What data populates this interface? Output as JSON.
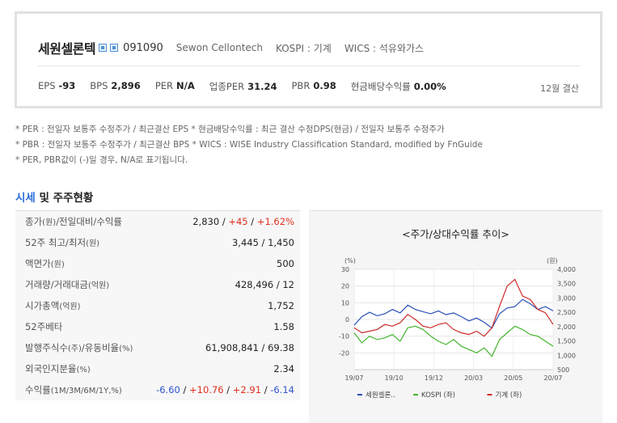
{
  "company": {
    "name": "세원셀론텍",
    "code": "091090",
    "english_name": "Sewon Cellontech",
    "market": "KOSPI : 기계",
    "wics": "WICS : 석유와가스"
  },
  "stats": {
    "eps_label": "EPS",
    "eps": "-93",
    "bps_label": "BPS",
    "bps": "2,896",
    "per_label": "PER",
    "per": "N/A",
    "industry_per_label": "업종PER",
    "industry_per": "31.24",
    "pbr_label": "PBR",
    "pbr": "0.98",
    "div_label": "현금배당수익률",
    "div": "0.00%",
    "settlement": "12월 결산"
  },
  "notes": [
    "* PER : 전일자 보통주 수정주가 / 최근결산 EPS * 현금배당수익률 : 최근 결산 수정DPS(현금) / 전일자 보통주 수정주가",
    "* PBR : 전일자 보통주 수정주가 / 최근결산 BPS * WICS : WISE Industry Classification Standard, modified by FnGuide",
    "* PER, PBR값이 (-)일 경우, N/A로 표기됩니다."
  ],
  "section": {
    "accent": "시세",
    "rest": " 및 주주현황"
  },
  "table": [
    {
      "label": "종가",
      "unit": "(원)",
      "label2": "/전일대비/수익률",
      "value": "2,830",
      "value2": "+45",
      "value3": "+1.62%"
    },
    {
      "label": "52주 최고/최저",
      "unit": "(원)",
      "value": "3,445 / 1,450"
    },
    {
      "label": "액면가",
      "unit": "(원)",
      "value": "500"
    },
    {
      "label": "거래량/거래대금",
      "unit": "(억원)",
      "value": "428,496 / 12"
    },
    {
      "label": "시가총액",
      "unit": "(억원)",
      "value": "1,752"
    },
    {
      "label": "52주베타",
      "unit": "",
      "value": "1.58"
    },
    {
      "label": "발행주식수",
      "unit": "(주)",
      "label2": "/유동비율",
      "unit2": "(%)",
      "value": "61,908,841 / 69.38"
    },
    {
      "label": "외국인지분율",
      "unit": "(%)",
      "value": "2.34"
    },
    {
      "label": "수익률",
      "unit": "(1M/3M/6M/1Y,%)",
      "returns": [
        "-6.60",
        "+10.76",
        "+2.91",
        "-6.14"
      ]
    }
  ],
  "chart_data": {
    "type": "line",
    "title": "<주가/상대수익률 추이>",
    "y_left_unit": "(%)",
    "y_right_unit": "(원)",
    "y_left_ticks": [
      "30",
      "20",
      "10",
      "0",
      "-10",
      "-20"
    ],
    "y_right_ticks": [
      "4,000",
      "3,500",
      "3,000",
      "2,500",
      "2,000",
      "1,500",
      "1,000",
      "500"
    ],
    "x_ticks": [
      "19/07",
      "19/10",
      "19/12",
      "20/03",
      "20/05",
      "20/07"
    ],
    "ylim_left": [
      -30,
      30
    ],
    "ylim_right": [
      500,
      4000
    ],
    "series": [
      {
        "name": "세원셀론..",
        "color": "#2b4fb8",
        "axis": "right",
        "x": [
          0,
          2,
          4,
          6,
          8,
          10,
          12,
          14,
          16,
          18,
          20,
          22,
          24,
          26,
          28,
          30,
          32,
          34,
          36,
          38,
          40,
          42,
          44,
          46,
          48,
          50,
          52
        ],
        "values": [
          2050,
          2350,
          2500,
          2380,
          2450,
          2600,
          2480,
          2750,
          2600,
          2520,
          2450,
          2550,
          2420,
          2480,
          2350,
          2200,
          2300,
          2150,
          1950,
          2450,
          2650,
          2700,
          2950,
          2800,
          2600,
          2700,
          2550
        ]
      },
      {
        "name": "KOSPI (좌)",
        "color": "#44b52e",
        "axis": "left",
        "x": [
          0,
          2,
          4,
          6,
          8,
          10,
          12,
          14,
          16,
          18,
          20,
          22,
          24,
          26,
          28,
          30,
          32,
          34,
          36,
          38,
          40,
          42,
          44,
          46,
          48,
          50,
          52
        ],
        "values": [
          -8,
          -14,
          -10,
          -12,
          -11,
          -9,
          -13,
          -5,
          -4,
          -6,
          -10,
          -13,
          -15,
          -12,
          -16,
          -18,
          -20,
          -17,
          -22,
          -12,
          -8,
          -4,
          -6,
          -9,
          -10,
          -13,
          -16
        ]
      },
      {
        "name": "기계 (좌)",
        "color": "#cc2a2a",
        "axis": "left",
        "x": [
          0,
          2,
          4,
          6,
          8,
          10,
          12,
          14,
          16,
          18,
          20,
          22,
          24,
          26,
          28,
          30,
          32,
          34,
          36,
          38,
          40,
          42,
          44,
          46,
          48,
          50,
          52
        ],
        "values": [
          -5,
          -8,
          -7,
          -6,
          -3,
          -4,
          -2,
          3,
          0,
          -4,
          -5,
          -3,
          -2,
          -6,
          -8,
          -9,
          -7,
          -10,
          -5,
          8,
          20,
          24,
          14,
          12,
          6,
          4,
          -3
        ]
      }
    ]
  }
}
